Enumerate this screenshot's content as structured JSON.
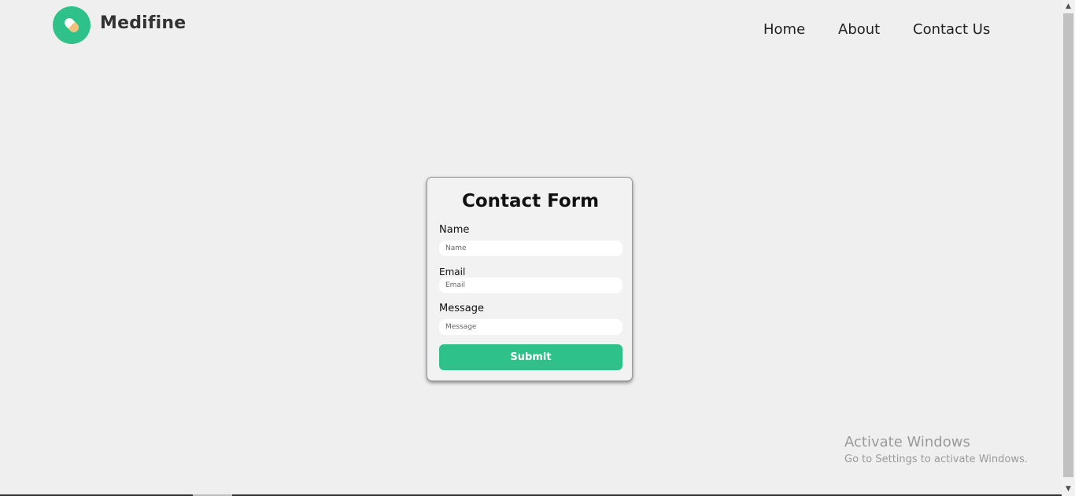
{
  "header": {
    "brand": "Medifine",
    "logo_icon": "pill-icon",
    "nav": {
      "home": "Home",
      "about": "About",
      "contact": "Contact Us"
    }
  },
  "form": {
    "title": "Contact Form",
    "name_label": "Name",
    "name_placeholder": "Name",
    "email_label": "Email",
    "email_placeholder": "Email",
    "message_label": "Message",
    "message_placeholder": "Message",
    "submit_label": "Submit"
  },
  "watermark": {
    "title": "Activate Windows",
    "subtitle": "Go to Settings to activate Windows."
  },
  "colors": {
    "accent": "#2ec28a",
    "background": "#efefef",
    "pill": "#f2c27a"
  }
}
